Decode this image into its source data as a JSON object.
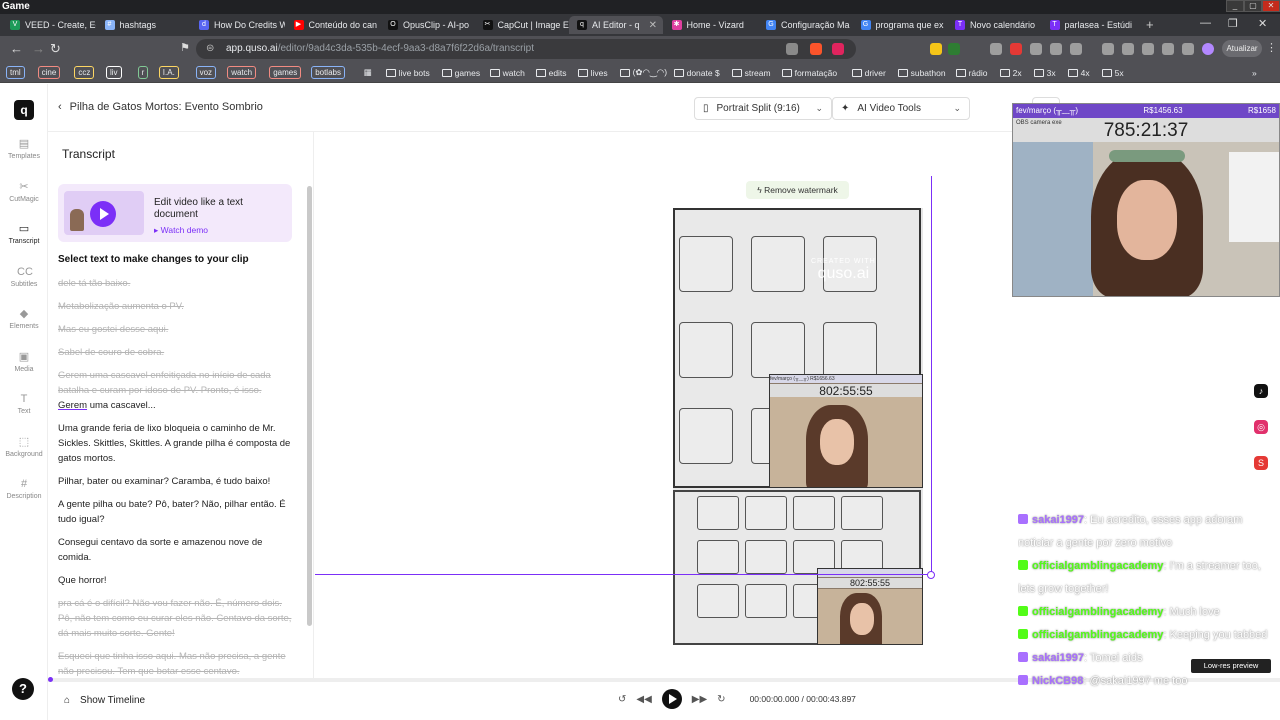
{
  "window": {
    "title": "Game"
  },
  "tabs": [
    {
      "label": "VEED - Create, Ed",
      "color": "#1d9b59",
      "glyph": "V"
    },
    {
      "label": "hashtags",
      "color": "#8ab4f8",
      "glyph": "#"
    },
    {
      "label": "How Do Credits W",
      "color": "#5865f2",
      "glyph": "d"
    },
    {
      "label": "Conteúdo do can",
      "color": "#ff0000",
      "glyph": "▶"
    },
    {
      "label": "OpusClip - AI-po",
      "color": "#111111",
      "glyph": "O"
    },
    {
      "label": "CapCut | Image E",
      "color": "#111111",
      "glyph": "✂"
    },
    {
      "label": "AI Editor - q",
      "color": "#111111",
      "glyph": "q"
    },
    {
      "label": "Home - Vizard",
      "color": "#e040a0",
      "glyph": "✱"
    },
    {
      "label": "Configuração Ma",
      "color": "#4285f4",
      "glyph": "G"
    },
    {
      "label": "programa que ex",
      "color": "#4285f4",
      "glyph": "G"
    },
    {
      "label": "Novo calendário",
      "color": "#7b2ff7",
      "glyph": "T"
    },
    {
      "label": "parlasea - Estúdi",
      "color": "#7b2ff7",
      "glyph": "T"
    }
  ],
  "active_tab_index": 6,
  "address": {
    "host": "app.quso.ai",
    "path": "/editor/9ad4c3da-535b-4ecf-9aa3-d8a7f6f22d6a/transcript"
  },
  "update_label": "Atualizar",
  "bookmarks": {
    "chips": [
      "tml",
      "cine",
      "ccz",
      "liv",
      "r",
      "I.A.",
      "voz",
      "watch",
      "games",
      "botlabs"
    ],
    "chip_colors": [
      "#8ab4f8",
      "#f28b82",
      "#fdd663",
      "#fff",
      "#81c995",
      "#fdd663",
      "#8ab4f8",
      "#f28b82",
      "#f28b82",
      "#8ab4f8"
    ],
    "items": [
      "live bots",
      "games",
      "watch",
      "edits",
      "lives",
      "(✿◠‿◠)",
      "donate $",
      "stream",
      "formatação",
      "driver",
      "subathon",
      "rádio",
      "2x",
      "3x",
      "4x",
      "5x"
    ]
  },
  "rail": {
    "logo": "q",
    "items": [
      {
        "label": "Templates",
        "icon": "▤"
      },
      {
        "label": "CutMagic",
        "icon": "✂"
      },
      {
        "label": "Transcript",
        "icon": "▭"
      },
      {
        "label": "Subtitles",
        "icon": "CC"
      },
      {
        "label": "Elements",
        "icon": "◆"
      },
      {
        "label": "Media",
        "icon": "▣"
      },
      {
        "label": "Text",
        "icon": "T"
      },
      {
        "label": "Background",
        "icon": "⬚"
      },
      {
        "label": "Description",
        "icon": "#"
      }
    ],
    "active_index": 2,
    "help": "?"
  },
  "topbar": {
    "back_label": "Pilha de Gatos Mortos: Evento Sombrio",
    "format_dropdown": "Portrait Split (9:16)",
    "tools_dropdown": "AI Video Tools"
  },
  "panel": {
    "title": "Transcript",
    "promo_title": "Edit video like a text document",
    "promo_link": "Watch demo",
    "hint": "Select text to make changes to your clip",
    "segments": [
      {
        "text": "dele tá tão baixo.",
        "deleted": true
      },
      {
        "text": "Metabolização aumenta o PV.",
        "deleted": true
      },
      {
        "text": "Mas eu gostei desse aqui.",
        "deleted": true
      },
      {
        "text": "Sabel de couro de cobra.",
        "deleted": true
      },
      {
        "text": "Gerem uma cascavel enfeitiçada no início de cada batalha e curam por idoso de PV. Pronto, é isso.",
        "deleted": true,
        "keep": "Gerem",
        "tail": "uma cascavel..."
      },
      {
        "text": "Uma grande feria de lixo bloqueia o caminho de Mr. Sickles. Skittles, Skittles. A grande pilha é composta de gatos mortos.",
        "deleted": false
      },
      {
        "text": "Pilhar, bater ou examinar? Caramba, é tudo baixo!",
        "deleted": false
      },
      {
        "text": "A gente pilha ou bate? Pô, bater? Não, pilhar então. É tudo igual?",
        "deleted": false
      },
      {
        "text": "Consegui centavo da sorte e amazenou nove de comida.",
        "deleted": false
      },
      {
        "text": "Que horror!",
        "deleted": false
      },
      {
        "text": "pra cá é o difícil? Não vou fazer não. É, número dois. Pô, não tem como eu curar eles não. Centavo da sorte, dá mais muito sorte. Gente!",
        "deleted": true
      },
      {
        "text": "Esqueci que tinha isso aqui. Mas não precisa, a gente não precisou. Tem que botar esse centavo.",
        "deleted": true
      }
    ]
  },
  "canvas": {
    "watermark_button": "Remove watermark",
    "watermark_small": "CREATED WITH",
    "watermark_big": "quso.ai",
    "cam_timer": "802:55:55",
    "cam_title": "fev/março (╥﹏╥)",
    "cam_amount": "R$1656.63"
  },
  "timeline": {
    "show_label": "Show Timeline",
    "timecode": "00:00:00.000 / 00:00:43.897",
    "progress": 0
  },
  "overlay": {
    "stream_title": "fev/março (╥﹏╥)",
    "stream_amount": "R$1456.63",
    "stream_right_amount": "R$1658",
    "stream_timer": "785:21:37",
    "stream_window": "OBS camera exe",
    "lowres_label": "Low-res preview",
    "chat": [
      {
        "user": "sakai1997",
        "msg": ": Eu acredito, esses app adoram noticiar a gente por zero motivo",
        "badge": "#a970ff"
      },
      {
        "user": "officialgamblingacademy",
        "msg": ": I'm a streamer too, lets grow together!",
        "badge": "#53fc18"
      },
      {
        "user": "officialgamblingacademy",
        "msg": ": Much love",
        "badge": "#53fc18"
      },
      {
        "user": "officialgamblingacademy",
        "msg": ": Keeping you tabbed",
        "badge": "#53fc18"
      },
      {
        "user": "sakai1997",
        "msg": ": Tomei aids",
        "badge": "#a970ff"
      },
      {
        "user": "NickCB98",
        "msg": ": @sakai1997 me too",
        "badge": "#a970ff"
      }
    ]
  }
}
